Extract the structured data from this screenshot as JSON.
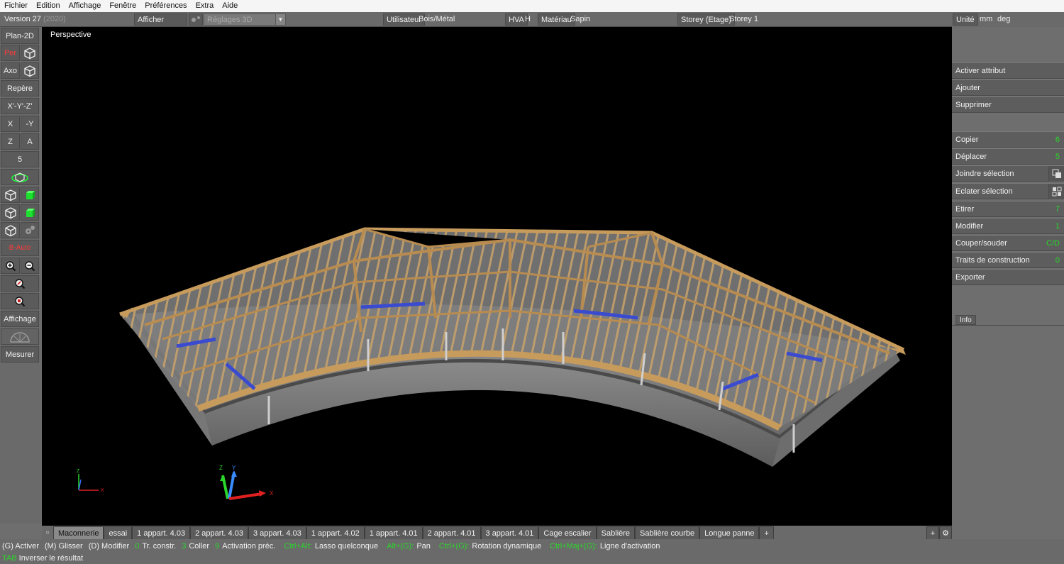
{
  "menu": [
    "Fichier",
    "Edition",
    "Affichage",
    "Fenêtre",
    "Préférences",
    "Extra",
    "Aide"
  ],
  "toolbar": {
    "version": "Version 27",
    "version_year": "(2020)",
    "show_attribute": "Afficher attribut",
    "settings3d": "Réglages 3D",
    "user_label": "Utilisateur",
    "user_value": "Bois/Métal",
    "hva_label": "HVA",
    "hva_value": "H",
    "material_label": "Matériau",
    "material_value": "Sapin",
    "storey_label": "Storey (Etage)",
    "storey_value": "Storey 1",
    "unit_label": "Unité",
    "unit_length": "mm",
    "unit_angle": "deg"
  },
  "left": {
    "plan2d": "Plan-2D",
    "per": "Per",
    "axo": "Axo",
    "repere": "Repère",
    "xyz": "X'-Y'-Z'",
    "x": "X",
    "my": "-Y",
    "z": "Z",
    "a": "A",
    "five": "5",
    "auto": "B-Auto",
    "affichage": "Affichage",
    "mesurer": "Mesurer"
  },
  "viewport": {
    "label": "Perspective"
  },
  "right": {
    "buttons": [
      {
        "label": "Activer attribut",
        "num": ""
      },
      {
        "label": "Ajouter",
        "num": ""
      },
      {
        "label": "Supprimer",
        "num": ""
      }
    ],
    "ops": [
      {
        "label": "Copier",
        "num": "6"
      },
      {
        "label": "Déplacer",
        "num": "5"
      },
      {
        "label": "Joindre sélection",
        "num": ""
      },
      {
        "label": "Eclater sélection",
        "num": ""
      },
      {
        "label": "Etirer",
        "num": "7"
      },
      {
        "label": "Modifier",
        "num": "1"
      },
      {
        "label": "Couper/souder",
        "num": "C/D"
      },
      {
        "label": "Traits de construction",
        "num": "0"
      },
      {
        "label": "Exporter",
        "num": ""
      }
    ],
    "info_tab": "Info"
  },
  "tabs": [
    "Maconnerie",
    "essai",
    "1 appart. 4.03",
    "2 appart. 4.03",
    "3 appart. 4.03",
    "1 appart. 4.02",
    "1 appart. 4.01",
    "2 appart. 4.01",
    "3 appart. 4.01",
    "Cage escalier",
    "Sablière",
    "Sablière courbe",
    "Longue panne",
    "+"
  ],
  "tab_plus_right": "+",
  "status": {
    "line1": [
      {
        "t": "(G) Activer",
        "g": false
      },
      {
        "t": "(M) Glisser",
        "g": false
      },
      {
        "t": "(D) Modifier",
        "g": false
      },
      {
        "t": "0",
        "g": true
      },
      {
        "t": "Tr. constr.",
        "g": false
      },
      {
        "t": "3",
        "g": true
      },
      {
        "t": "Coller",
        "g": false
      },
      {
        "t": "9",
        "g": true
      },
      {
        "t": "Activation préc.",
        "g": false
      },
      {
        "t": "Ctrl+Alt:",
        "g": true
      },
      {
        "t": "Lasso quelconque",
        "g": false
      },
      {
        "t": "Alt+(G):",
        "g": true
      },
      {
        "t": "Pan",
        "g": false
      },
      {
        "t": "Ctrl+(G):",
        "g": true
      },
      {
        "t": "Rotation dynamique",
        "g": false
      },
      {
        "t": "Ctrl+Maj+(G):",
        "g": true
      },
      {
        "t": "Ligne d'activation",
        "g": false
      }
    ],
    "tab_key": "TAB",
    "line2": "Inverser le résultat"
  },
  "axis": {
    "x": "X",
    "y": "Y",
    "z": "Z"
  }
}
